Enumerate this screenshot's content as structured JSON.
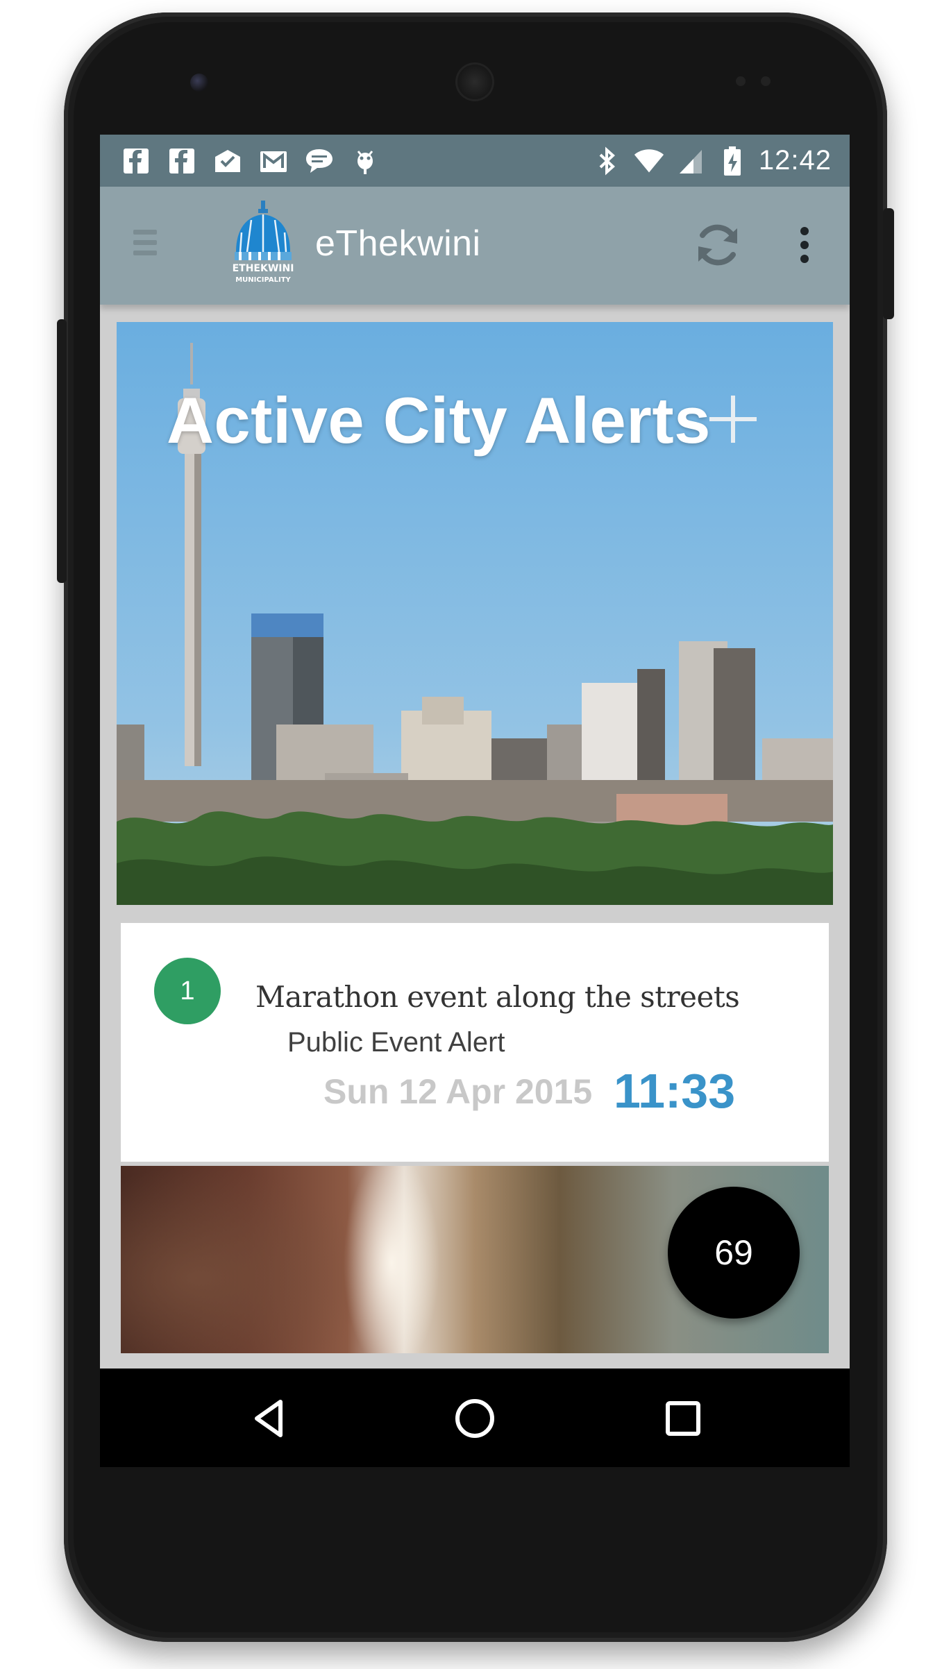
{
  "status_bar": {
    "time": "12:42",
    "icons_left": [
      "facebook-icon",
      "facebook-icon",
      "inbox-check-icon",
      "gmail-icon",
      "chat-icon",
      "bug-icon"
    ],
    "icons_right": [
      "bluetooth-icon",
      "wifi-icon",
      "signal-icon",
      "battery-charging-icon"
    ]
  },
  "toolbar": {
    "title": "eThekwini",
    "logo_text": "ETHEKWINI MUNICIPALITY",
    "menu_icon": "hamburger-icon",
    "refresh_icon": "refresh-icon",
    "overflow_icon": "more-vert-icon"
  },
  "hero": {
    "title": "Active City Alerts",
    "add_icon": "plus-icon"
  },
  "alerts": [
    {
      "number": "1",
      "title": "Marathon event along the streets",
      "type": "Public Event Alert",
      "date": "Sun 12 Apr 2015",
      "time": "11:33",
      "badge_color": "#2f9e63"
    }
  ],
  "fab": {
    "label": "69"
  },
  "nav_bar": {
    "icons": [
      "back-icon",
      "home-icon",
      "recents-icon"
    ]
  },
  "colors": {
    "status_bar": "#5f7780",
    "toolbar": "#8fa2a9",
    "accent_time": "#3a93c9",
    "badge": "#2f9e63"
  }
}
